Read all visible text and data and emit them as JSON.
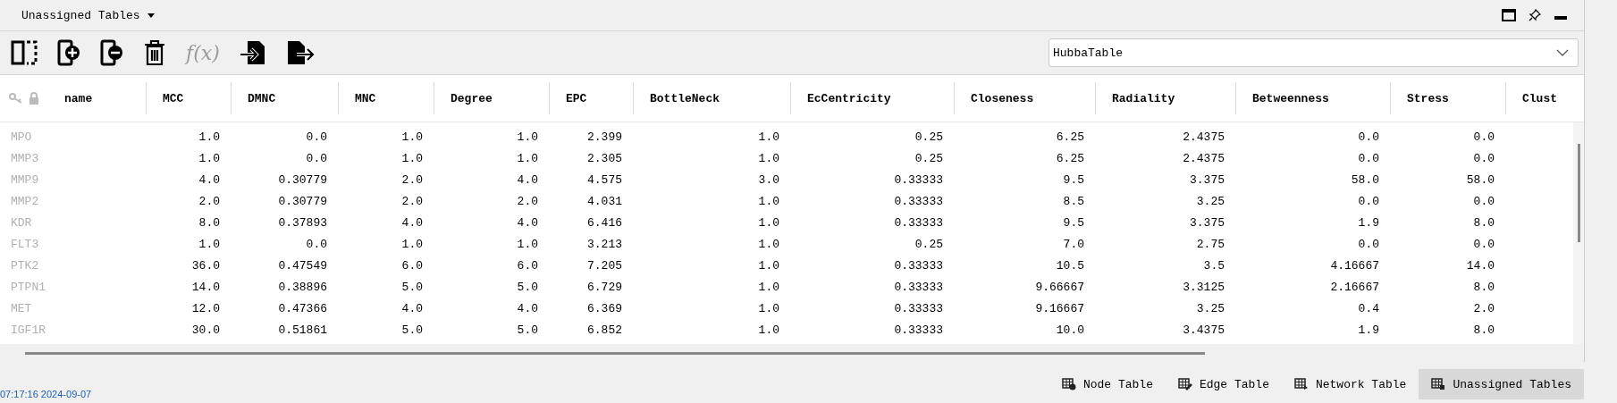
{
  "panel": {
    "title": "Unassigned Tables"
  },
  "toolbar": {
    "tools": [
      {
        "kind": "columns"
      },
      {
        "kind": "add"
      },
      {
        "kind": "remove"
      },
      {
        "kind": "delete"
      },
      {
        "kind": "function",
        "label": "f(x)",
        "disabled": true
      },
      {
        "kind": "import"
      },
      {
        "kind": "export"
      }
    ]
  },
  "table_selector": {
    "value": "HubbaTable"
  },
  "table": {
    "columns": [
      "name",
      "MCC",
      "DMNC",
      "MNC",
      "Degree",
      "EPC",
      "BottleNeck",
      "EcCentricity",
      "Closeness",
      "Radiality",
      "Betweenness",
      "Stress",
      "Clust"
    ],
    "rows": [
      {
        "name": "MPO",
        "cells": [
          "1.0",
          "0.0",
          "1.0",
          "1.0",
          "2.399",
          "1.0",
          "0.25",
          "6.25",
          "2.4375",
          "0.0",
          "0.0"
        ]
      },
      {
        "name": "MMP3",
        "cells": [
          "1.0",
          "0.0",
          "1.0",
          "1.0",
          "2.305",
          "1.0",
          "0.25",
          "6.25",
          "2.4375",
          "0.0",
          "0.0"
        ]
      },
      {
        "name": "MMP9",
        "cells": [
          "4.0",
          "0.30779",
          "2.0",
          "4.0",
          "4.575",
          "3.0",
          "0.33333",
          "9.5",
          "3.375",
          "58.0",
          "58.0"
        ]
      },
      {
        "name": "MMP2",
        "cells": [
          "2.0",
          "0.30779",
          "2.0",
          "2.0",
          "4.031",
          "1.0",
          "0.33333",
          "8.5",
          "3.25",
          "0.0",
          "0.0"
        ]
      },
      {
        "name": "KDR",
        "cells": [
          "8.0",
          "0.37893",
          "4.0",
          "4.0",
          "6.416",
          "1.0",
          "0.33333",
          "9.5",
          "3.375",
          "1.9",
          "8.0"
        ]
      },
      {
        "name": "FLT3",
        "cells": [
          "1.0",
          "0.0",
          "1.0",
          "1.0",
          "3.213",
          "1.0",
          "0.25",
          "7.0",
          "2.75",
          "0.0",
          "0.0"
        ]
      },
      {
        "name": "PTK2",
        "cells": [
          "36.0",
          "0.47549",
          "6.0",
          "6.0",
          "7.205",
          "1.0",
          "0.33333",
          "10.5",
          "3.5",
          "4.16667",
          "14.0"
        ]
      },
      {
        "name": "PTPN1",
        "cells": [
          "14.0",
          "0.38896",
          "5.0",
          "5.0",
          "6.729",
          "1.0",
          "0.33333",
          "9.66667",
          "3.3125",
          "2.16667",
          "8.0"
        ]
      },
      {
        "name": "MET",
        "cells": [
          "12.0",
          "0.47366",
          "4.0",
          "4.0",
          "6.369",
          "1.0",
          "0.33333",
          "9.16667",
          "3.25",
          "0.4",
          "2.0"
        ]
      },
      {
        "name": "IGF1R",
        "cells": [
          "30.0",
          "0.51861",
          "5.0",
          "5.0",
          "6.852",
          "1.0",
          "0.33333",
          "10.0",
          "3.4375",
          "1.9",
          "8.0"
        ]
      }
    ]
  },
  "status_bar": {
    "time": "07:17:16 2024-09-07"
  },
  "bottom_tabs": [
    {
      "kind": "node",
      "label": "Node Table",
      "selected": false
    },
    {
      "kind": "edge",
      "label": "Edge Table",
      "selected": false
    },
    {
      "kind": "network",
      "label": "Network Table",
      "selected": false
    },
    {
      "kind": "unassigned",
      "label": "Unassigned Tables",
      "selected": true
    }
  ]
}
